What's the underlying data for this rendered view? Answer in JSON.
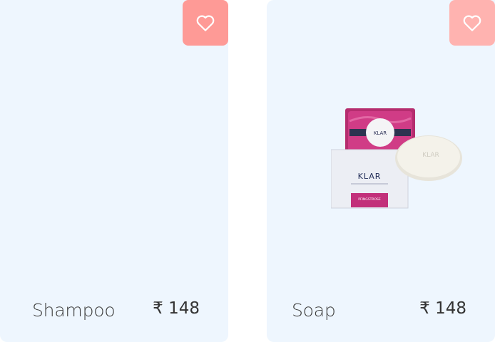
{
  "products": [
    {
      "name": "Shampoo",
      "price": "₹ 148",
      "favorite_icon": "heart-outline-icon",
      "has_image": false
    },
    {
      "name": "Soap",
      "price": "₹ 148",
      "favorite_icon": "heart-outline-icon",
      "has_image": true,
      "image": {
        "brand": "KLAR",
        "sub": "PFINGSTROSE"
      }
    }
  ],
  "colors": {
    "card_bg": "#eef6fe",
    "favorite_active": "#fe9a96",
    "favorite_light": "#ffb3b0",
    "soap_wrap": "#c2307a"
  }
}
